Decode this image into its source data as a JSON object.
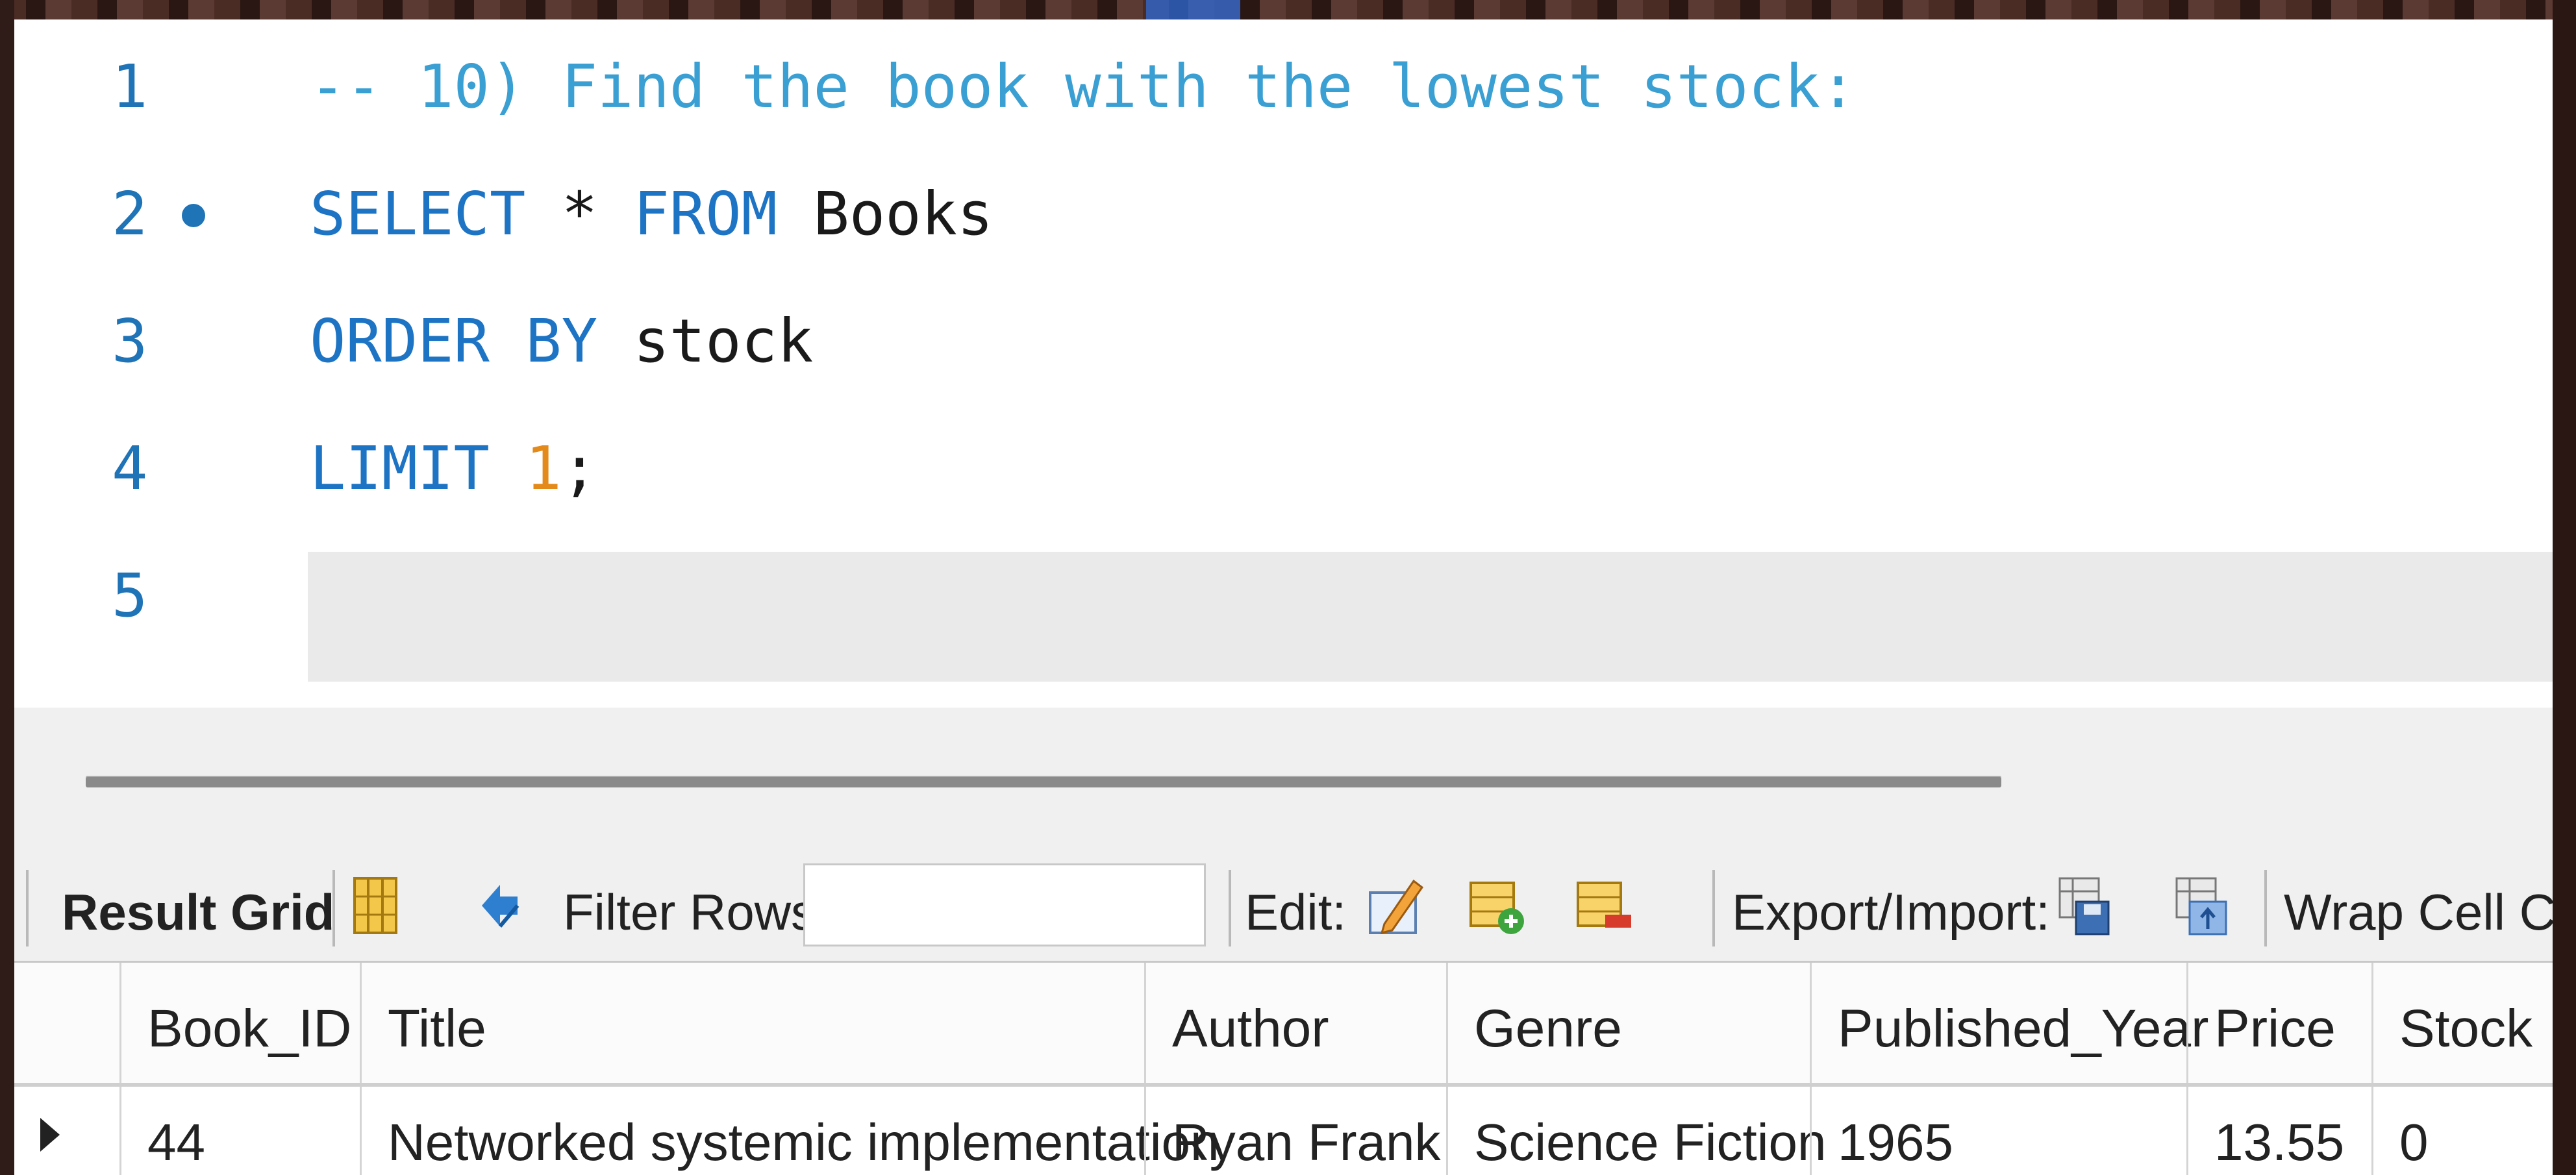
{
  "editor": {
    "lines": [
      {
        "num": "1",
        "comment": "-- 10) Find the book with the lowest stock:"
      },
      {
        "num": "2",
        "kw1": "SELECT",
        "p1": " * ",
        "kw2": "FROM",
        "p2": " Books"
      },
      {
        "num": "3",
        "kw1": "ORDER BY",
        "p1": " stock"
      },
      {
        "num": "4",
        "kw1": "LIMIT",
        "n": "1",
        "p1": ";"
      },
      {
        "num": "5"
      }
    ]
  },
  "toolbar": {
    "result_grid": "Result Grid",
    "filter_rows": "Filter Rows:",
    "filter_value": "",
    "edit": "Edit:",
    "export_import": "Export/Import:",
    "wrap_cell": "Wrap Cell Con"
  },
  "grid": {
    "columns": [
      "Book_ID",
      "Title",
      "Author",
      "Genre",
      "Published_Year",
      "Price",
      "Stock"
    ],
    "rows": [
      [
        "44",
        "Networked systemic implementation",
        "Ryan Frank",
        "Science Fiction",
        "1965",
        "13.55",
        "0"
      ]
    ]
  },
  "colors": {
    "keyword": "#1e74c4",
    "comment": "#3a9fd3",
    "number": "#e38a1a",
    "line_number": "#1f73b7"
  },
  "icons": [
    "toggle-columns-icon",
    "refresh-icon",
    "edit-cell-icon",
    "add-row-icon",
    "delete-row-icon",
    "export-icon",
    "import-icon",
    "row-selector-icon"
  ]
}
